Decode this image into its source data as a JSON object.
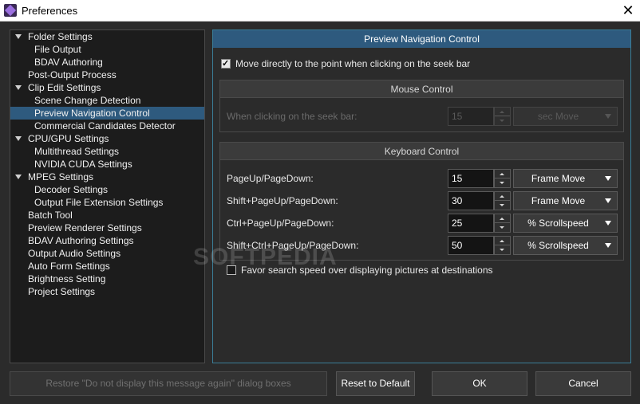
{
  "window": {
    "title": "Preferences"
  },
  "tree": {
    "items": [
      {
        "label": "Folder Settings",
        "expandable": true
      },
      {
        "label": "File Output"
      },
      {
        "label": "BDAV Authoring"
      },
      {
        "label": "Post-Output Process"
      },
      {
        "label": "Clip Edit Settings",
        "expandable": true
      },
      {
        "label": "Scene Change Detection"
      },
      {
        "label": "Preview Navigation Control",
        "selected": true
      },
      {
        "label": "Commercial Candidates Detector"
      },
      {
        "label": "CPU/GPU Settings",
        "expandable": true
      },
      {
        "label": "Multithread Settings"
      },
      {
        "label": "NVIDIA CUDA Settings"
      },
      {
        "label": "MPEG Settings",
        "expandable": true
      },
      {
        "label": "Decoder Settings"
      },
      {
        "label": "Output File Extension Settings"
      },
      {
        "label": "Batch Tool"
      },
      {
        "label": "Preview Renderer Settings"
      },
      {
        "label": "BDAV Authoring Settings"
      },
      {
        "label": "Output Audio Settings"
      },
      {
        "label": "Auto Form Settings"
      },
      {
        "label": "Brightness Setting"
      },
      {
        "label": "Project Settings"
      }
    ]
  },
  "panel": {
    "title": "Preview Navigation Control",
    "seek_checkbox": {
      "label": "Move directly to the point when clicking on the seek bar",
      "checked": true
    },
    "mouse_group": {
      "title": "Mouse Control",
      "row": {
        "label": "When clicking on the seek bar:",
        "value": "15",
        "unit": "sec Move",
        "disabled": true
      }
    },
    "keyboard_group": {
      "title": "Keyboard Control",
      "rows": [
        {
          "label": "PageUp/PageDown:",
          "value": "15",
          "unit": "Frame Move"
        },
        {
          "label": "Shift+PageUp/PageDown:",
          "value": "30",
          "unit": "Frame Move"
        },
        {
          "label": "Ctrl+PageUp/PageDown:",
          "value": "25",
          "unit": "% Scrollspeed"
        },
        {
          "label": "Shift+Ctrl+PageUp/PageDown:",
          "value": "50",
          "unit": "% Scrollspeed"
        }
      ]
    },
    "favor_checkbox": {
      "label": "Favor search speed over displaying pictures at destinations",
      "checked": false
    }
  },
  "buttons": {
    "restore": "Restore \"Do not display this message again\" dialog boxes",
    "reset": "Reset to Default",
    "ok": "OK",
    "cancel": "Cancel"
  },
  "watermark": "SOFTPEDIA",
  "colors": {
    "accent": "#2e5a7e",
    "panel_border": "#3a7e98",
    "background": "#2b2b2b"
  }
}
